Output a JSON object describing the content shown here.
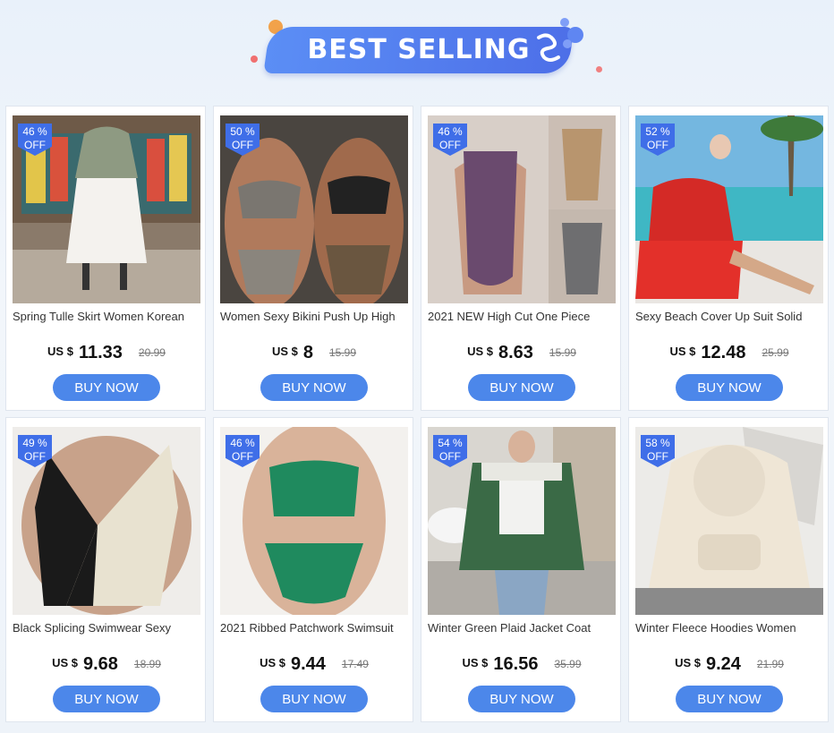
{
  "banner": {
    "title": "BEST SELLING"
  },
  "colors": {
    "accent": "#4c87ea",
    "badge": "#3f6ee8",
    "banner": "#5b8ef5"
  },
  "buy_label": "BUY NOW",
  "currency": "US $",
  "badge_off": "OFF",
  "products": [
    {
      "discount": "46 %",
      "title": "Spring Tulle Skirt Women Korean",
      "price": "11.33",
      "old_price": "20.99",
      "image": "white tulle skirt outfit"
    },
    {
      "discount": "50 %",
      "title": "Women Sexy Bikini Push Up High",
      "price": "8",
      "old_price": "15.99",
      "image": "snake and leopard print bikinis"
    },
    {
      "discount": "46 %",
      "title": "2021 NEW High Cut One Piece",
      "price": "8.63",
      "old_price": "15.99",
      "image": "glitter one piece swimsuit"
    },
    {
      "discount": "52 %",
      "title": "Sexy Beach Cover Up Suit Solid",
      "price": "12.48",
      "old_price": "25.99",
      "image": "red beach cover up by pool"
    },
    {
      "discount": "49 %",
      "title": "Black Splicing Swimwear Sexy",
      "price": "9.68",
      "old_price": "18.99",
      "image": "black and cream swimsuit"
    },
    {
      "discount": "46 %",
      "title": "2021 Ribbed Patchwork Swimsuit",
      "price": "9.44",
      "old_price": "17.49",
      "image": "green ribbed bikini"
    },
    {
      "discount": "54 %",
      "title": "Winter Green Plaid Jacket Coat",
      "price": "16.56",
      "old_price": "35.99",
      "image": "green plaid jacket street photo"
    },
    {
      "discount": "58 %",
      "title": "Winter Fleece Hoodies Women",
      "price": "9.24",
      "old_price": "21.99",
      "image": "beige fleece hoodie"
    }
  ]
}
